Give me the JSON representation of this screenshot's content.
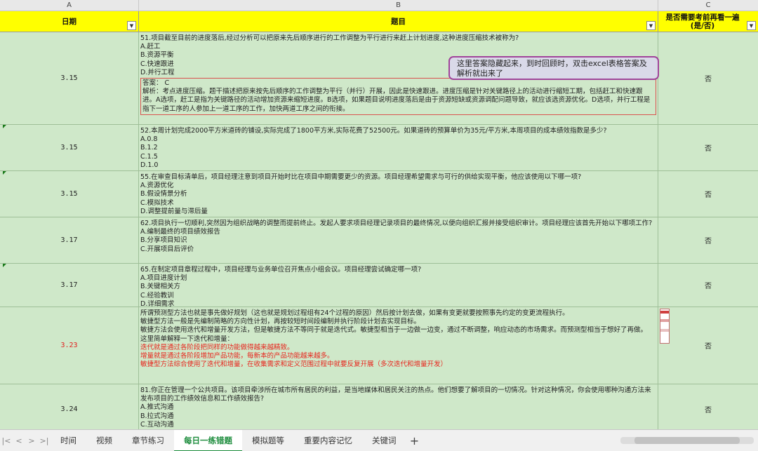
{
  "columns": {
    "a": "A",
    "b": "B",
    "c": "C"
  },
  "header": {
    "date": "日期",
    "question": "题目",
    "review": "是否需要考前再看一遍\n(是/否)"
  },
  "callout": "这里答案隐藏起来，到时回顾时，双击excel表格答案及解析就出来了",
  "rows": [
    {
      "date": "3.15",
      "answer": "否",
      "lines": [
        "51.项目截至目前的进度落后,经过分析可以把原来先后顺序进行的工作调整为平行进行来赶上计划进度,这种进度压缩技术被称为?",
        "A.赶工",
        "B.资源平衡",
        "C.快速跟进",
        "D.并行工程"
      ],
      "box": [
        "答案：  C",
        "解析：考点进度压缩。题干描述把原来按先后顺序的工作调整为平行（并行）开展，因此是快速跟进。进度压缩是针对关键路径上的活动进行缩短工期，包括赶工和快速跟进。A选项，赶工是指为关键路径的活动增加资源来缩短进度。B选项，如果题目说明进度落后是由于资源短缺或资源调配问题导致，就应该选资源优化。D选项，并行工程是指下一道工序的人参加上一道工序的工作，加快两道工序之间的衔接。"
      ]
    },
    {
      "date": "3.15",
      "answer": "否",
      "lines": [
        "52.本周计划完成2000平方米道砖的铺设,实际完成了1800平方米,实际花费了52500元。如果道砖的预算单价为35元/平方米,本周项目的成本绩效指数是多少?",
        "A.0.8",
        "B.1.2",
        "C.1.5",
        "D.1.0"
      ]
    },
    {
      "date": "3.15",
      "answer": "否",
      "lines": [
        "55.在审查目标清单后，项目经理注意到项目开始时比在项目中期需要更少的资源。项目经理希望需求与可行的供给实现平衡，他应该使用以下哪一项?",
        "A.资源优化",
        "B.假设情景分析",
        "C.模拟技术",
        "D.调整提前量与滞后量"
      ]
    },
    {
      "date": "3.17",
      "answer": "否",
      "lines": [
        "62.项目执行一切顺利,突然因为组织战略的调整而提前终止。发起人要求项目经理记录项目的最终情况,以便向组织汇报并接受组织审计。项目经理应该首先开始以下哪项工作?",
        "A.编制最终的项目绩效报告",
        "B.分享项目知识",
        "C.开展项目后评价"
      ]
    },
    {
      "date": "3.17",
      "answer": "否",
      "lines": [
        "65.在制定项目章程过程中，项目经理与业务单位召开焦点小组会议。项目经理尝试确定哪一项?",
        "A.项目进度计划",
        "B.关键相关方",
        "C.经验教训",
        "D.详细需求"
      ]
    },
    {
      "date": "3.23",
      "answer": "否",
      "lines": [
        "所谓预测型方法也就是事先做好规划（这也就是规划过程组有24个过程的原因）然后按计划去做，如果有变更就要按照事先约定的变更流程执行。",
        "敏捷型方法一般是先编制简略的方向性计划，再按较短时间段编制并执行阶段计划去实现目标。",
        "敏捷方法会使用迭代和增量开发方法，但是敏捷方法不等同于就是迭代式。敏捷型相当于一边做一边变，通过不断调整，响应动态的市场需求。而预测型相当于想好了再做。",
        "这里简单解释一下迭代和增量：",
        "迭代就是通过各阶段把同样的功能做得越来越精致。",
        "增量就是通过各阶段增加产品功能，每新本的产品功能越来越多。",
        "敏捷型方法综合使用了迭代和增量，在收集需求和定义范围过程中就要反复开展（多次迭代和增量开发）"
      ]
    },
    {
      "date": "3.24",
      "answer": "否",
      "lines": [
        "81.你正在管理一个公共项目。该项目牵涉所在城市所有居民的利益，是当地媒体和居民关注的热点。他们想要了解项目的一切情况。针对这种情况，你会使用哪种沟通方法来发布项目的工作绩效信息和工作绩效报告?",
        "A.推式沟通",
        "B.拉式沟通",
        "C.互动沟通"
      ]
    }
  ],
  "tabs": [
    "时间",
    "视频",
    "章节练习",
    "每日一练错题",
    "模拟题等",
    "重要内容记忆",
    "关键词"
  ],
  "active_tab": "每日一练错题",
  "icons": {
    "filter": "filter-dropdown-icon",
    "add": "plus-icon",
    "nav": [
      "first-sheet-icon",
      "prev-sheet-icon",
      "next-sheet-icon",
      "last-sheet-icon"
    ]
  },
  "nav_glyphs": [
    "|<",
    "<",
    ">",
    ">|"
  ],
  "add_glyph": "+",
  "colors": {
    "header_bg": "#ffff00",
    "row_bg": "#cfe8c9",
    "active_tab": "#1c8c3c",
    "callout_border": "#a0449a",
    "red_text": "#e8241c"
  }
}
